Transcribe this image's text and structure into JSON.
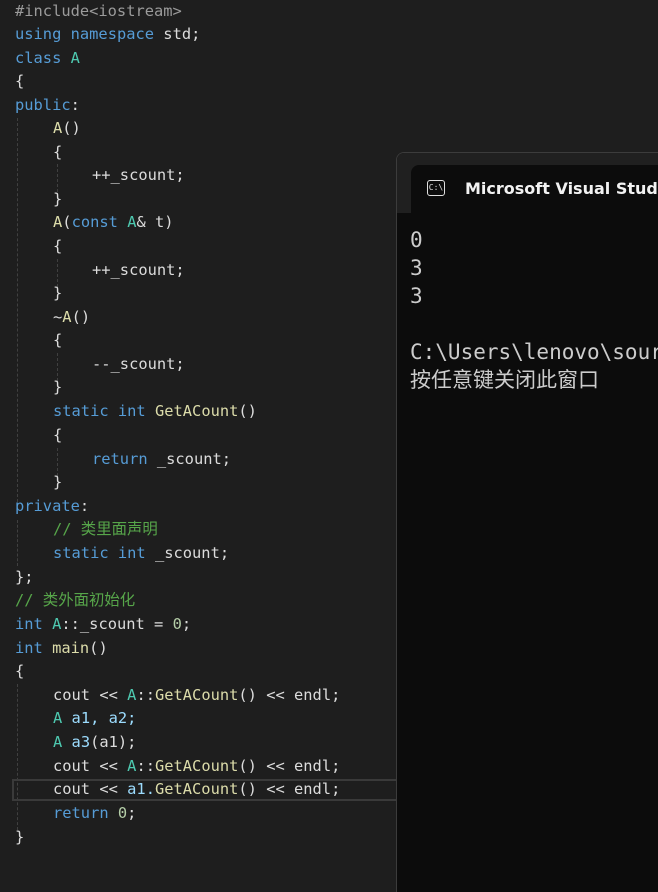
{
  "code": {
    "l1_include": "#include<iostream>",
    "l2_using": "using",
    "l2_namespace": "namespace",
    "l2_std": " std;",
    "l3_class": "class",
    "l3_name": "A",
    "brace_open": "{",
    "brace_close": "}",
    "l5_public": "public",
    "colon": ":",
    "l6_ctor": "A",
    "parens": "()",
    "l9_incr": "++_scount;",
    "l11_ctor": "A",
    "l11_paren_open": "(",
    "l11_const": "const",
    "l11_type": "A",
    "l11_ref": "& t)",
    "l15_tilde": "~",
    "l15_dtor": "A",
    "l17_decr": "--_scount;",
    "l19_static": "static",
    "l19_int": "int",
    "l19_fn": "GetACount",
    "l21_return": "return",
    "l21_var": " _scount;",
    "l23_private": "private",
    "l24_comment": "// 类里面声明",
    "l25_static": "static",
    "l25_int": "int",
    "l25_var": " _scount;",
    "l26_end": "};",
    "l27_comment": "// 类外面初始化",
    "l28_int": "int",
    "l28_scope": "A",
    "l28_rest": "::_scount = ",
    "l28_num": "0",
    "l28_semi": ";",
    "l29_int": "int",
    "l29_main": "main",
    "cout": "cout",
    "shl": " << ",
    "scope_a": "A",
    "scope_op": "::",
    "getacount": "GetACount",
    "endl": "endl",
    "semi": ";",
    "l32_type": "A",
    "l32_vars": " a1, a2;",
    "l33_type": "A",
    "l33_var": " a3",
    "l33_arg": "(a1);",
    "a1_dot": "a1.",
    "l36_return": "return",
    "l36_num": "0",
    "zero_semi": ";"
  },
  "console": {
    "title": "Microsoft Visual Studio",
    "icon_text": "C:\\",
    "output_lines": [
      "0",
      "3",
      "3",
      "",
      "C:\\Users\\lenovo\\source",
      "按任意键关闭此窗口"
    ]
  },
  "colors": {
    "editor_bg": "#1e1e1e",
    "keyword": "#569cd6",
    "type": "#4ec9b0",
    "function": "#dcdcaa",
    "comment": "#57a64a",
    "console_bg": "#0c0c0c"
  }
}
